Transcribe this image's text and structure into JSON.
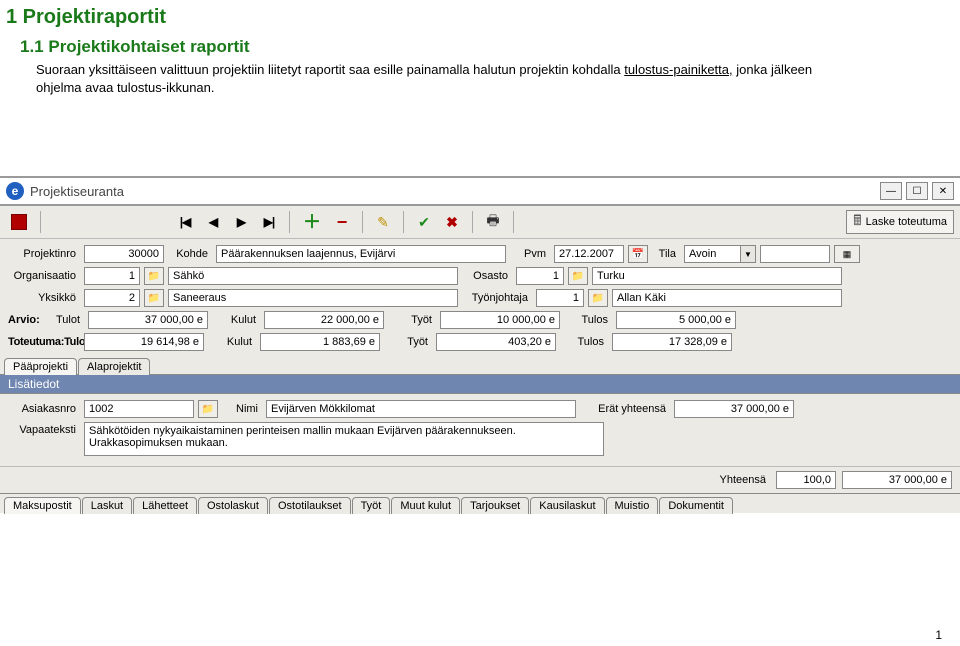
{
  "doc": {
    "h1": "1 Projektiraportit",
    "h2": "1.1 Projektikohtaiset raportit",
    "para_before": "Suoraan yksittäiseen valittuun projektiin liitetyt raportit saa esille painamalla halutun projektin kohdalla ",
    "para_link": "tulostus-painiketta,",
    "para_after": " jonka jälkeen ohjelma avaa tulostus-ikkunan.",
    "footer": "1"
  },
  "window": {
    "title": "Projektiseuranta",
    "logo": "e",
    "compute_label": "Laske toteutuma"
  },
  "labels": {
    "projektinro": "Projektinro",
    "kohde": "Kohde",
    "pvm": "Pvm",
    "tila": "Tila",
    "organisaatio": "Organisaatio",
    "osasto": "Osasto",
    "yksikko": "Yksikkö",
    "tyonjohtaja": "Työnjohtaja",
    "arvio": "Arvio:",
    "toteutuma": "Toteutuma:",
    "tulot": "Tulot",
    "kulut": "Kulut",
    "tyot": "Työt",
    "tulos": "Tulos",
    "asiakasnro": "Asiakasnro",
    "nimi": "Nimi",
    "erat": "Erät yhteensä",
    "vapaateksti": "Vapaateksti",
    "yhteensa": "Yhteensä"
  },
  "form": {
    "projektinro": "30000",
    "kohde": "Päärakennuksen laajennus, Evijärvi",
    "pvm": "27.12.2007",
    "tila": "Avoin",
    "org_no": "1",
    "org_name": "Sähkö",
    "osasto_no": "1",
    "osasto_name": "Turku",
    "yksikko_no": "2",
    "yksikko_name": "Saneeraus",
    "tj_no": "1",
    "tj_name": "Allan Käki"
  },
  "arvio": {
    "tulot": "37 000,00 e",
    "kulut": "22 000,00 e",
    "tyot": "10 000,00 e",
    "tulos": "5 000,00 e"
  },
  "toteutuma": {
    "tulot": "19 614,98 e",
    "kulut": "1 883,69 e",
    "tyot": "403,20 e",
    "tulos": "17 328,09 e"
  },
  "tabs_top": {
    "paaprojekti": "Pääprojekti",
    "alaprojektit": "Alaprojektit"
  },
  "section_lisatiedot": "Lisätiedot",
  "lisatiedot": {
    "asiakasnro": "1002",
    "nimi": "Evijärven Mökkilomat",
    "erat": "37 000,00 e",
    "vapaateksti": "Sähkötöiden nykyaikaistaminen perinteisen mallin mukaan Evijärven päärakennukseen.\nUrakkasopimuksen mukaan."
  },
  "totals": {
    "pct": "100,0",
    "sum": "37 000,00 e"
  },
  "tabs_bottom": {
    "t1": "Maksupostit",
    "t2": "Laskut",
    "t3": "Lähetteet",
    "t4": "Ostolaskut",
    "t5": "Ostotilaukset",
    "t6": "Työt",
    "t7": "Muut kulut",
    "t8": "Tarjoukset",
    "t9": "Kausilaskut",
    "t10": "Muistio",
    "t11": "Dokumentit"
  }
}
